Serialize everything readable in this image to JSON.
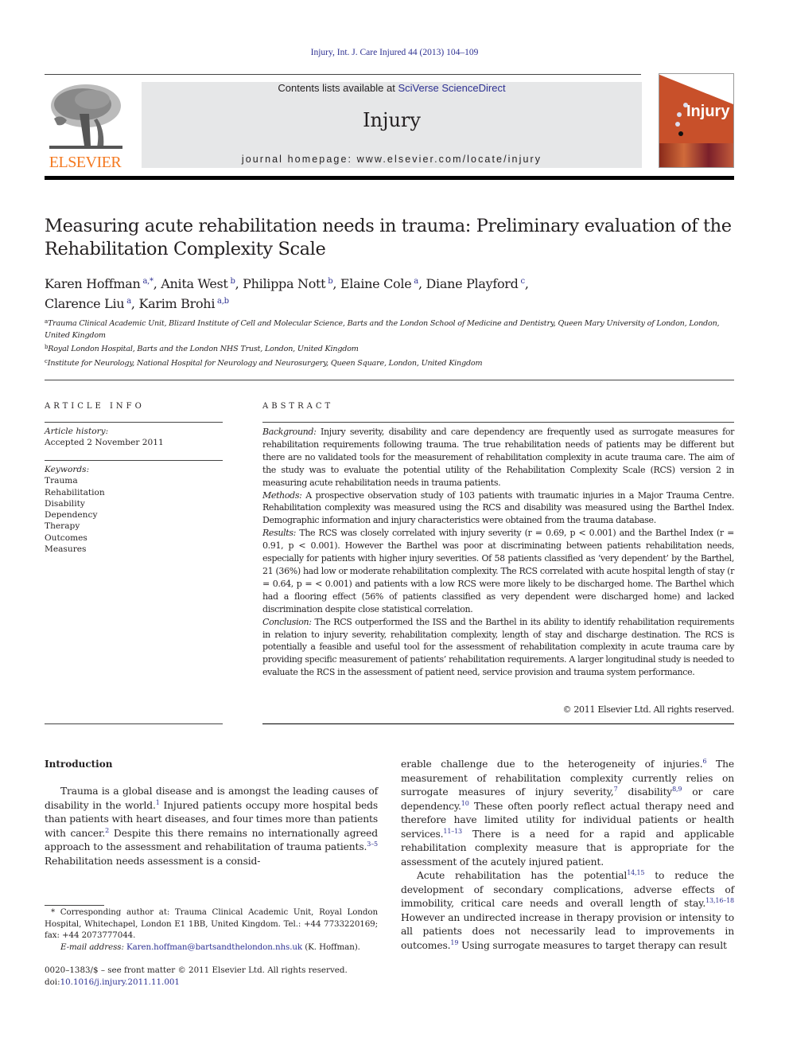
{
  "header": {
    "citation": "Injury, Int. J. Care Injured 44 (2013) 104–109",
    "contents_prefix": "Contents lists available at ",
    "contents_link": "SciVerse ScienceDirect",
    "journal_title": "Injury",
    "homepage": "journal homepage: www.elsevier.com/locate/injury",
    "publisher_wordmark": "ELSEVIER",
    "cover_title": "Injury",
    "colors": {
      "link": "#2e3192",
      "elsevier_orange": "#f47920",
      "banner_bg": "#e6e7e8",
      "cover_bg": "#c8502a"
    }
  },
  "article": {
    "title": "Measuring acute rehabilitation needs in trauma: Preliminary evaluation of the Rehabilitation Complexity Scale",
    "authors": [
      {
        "name": "Karen Hoffman",
        "sup": "a,*",
        "sep": ", "
      },
      {
        "name": "Anita West",
        "sup": "b",
        "sep": ", "
      },
      {
        "name": "Philippa Nott",
        "sup": "b",
        "sep": ", "
      },
      {
        "name": "Elaine Cole",
        "sup": "a",
        "sep": ", "
      },
      {
        "name": "Diane Playford",
        "sup": "c",
        "sep": ","
      },
      {
        "name": "Clarence Liu",
        "sup": "a",
        "sep": ", "
      },
      {
        "name": "Karim Brohi",
        "sup": "a,b",
        "sep": ""
      }
    ],
    "affiliations": [
      {
        "key": "a",
        "text": "Trauma Clinical Academic Unit, Blizard Institute of Cell and Molecular Science, Barts and the London School of Medicine and Dentistry, Queen Mary University of London, London, United Kingdom"
      },
      {
        "key": "b",
        "text": "Royal London Hospital, Barts and the London NHS Trust, London, United Kingdom"
      },
      {
        "key": "c",
        "text": "Institute for Neurology, National Hospital for Neurology and Neurosurgery, Queen Square, London, United Kingdom"
      }
    ]
  },
  "article_info": {
    "heading": "ARTICLE INFO",
    "history_label": "Article history:",
    "history_value": "Accepted 2 November 2011",
    "keywords_label": "Keywords:",
    "keywords": [
      "Trauma",
      "Rehabilitation",
      "Disability",
      "Dependency",
      "Therapy",
      "Outcomes",
      "Measures"
    ]
  },
  "abstract": {
    "heading": "ABSTRACT",
    "sections": [
      {
        "label": "Background:",
        "text": " Injury severity, disability and care dependency are frequently used as surrogate measures for rehabilitation requirements following trauma. The true rehabilitation needs of patients may be different but there are no validated tools for the measurement of rehabilitation complexity in acute trauma care. The aim of the study was to evaluate the potential utility of the Rehabilitation Complexity Scale (RCS) version 2 in measuring acute rehabilitation needs in trauma patients."
      },
      {
        "label": "Methods:",
        "text": " A prospective observation study of 103 patients with traumatic injuries in a Major Trauma Centre. Rehabilitation complexity was measured using the RCS and disability was measured using the Barthel Index. Demographic information and injury characteristics were obtained from the trauma database."
      },
      {
        "label": "Results:",
        "text": " The RCS was closely correlated with injury severity (r = 0.69, p < 0.001) and the Barthel Index (r = 0.91, p < 0.001). However the Barthel was poor at discriminating between patients rehabilitation needs, especially for patients with higher injury severities. Of 58 patients classified as ‘very dependent’ by the Barthel, 21 (36%) had low or moderate rehabilitation complexity. The RCS correlated with acute hospital length of stay (r = 0.64, p = < 0.001) and patients with a low RCS were more likely to be discharged home. The Barthel which had a flooring effect (56% of patients classified as very dependent were discharged home) and lacked discrimination despite close statistical correlation."
      },
      {
        "label": "Conclusion:",
        "text": " The RCS outperformed the ISS and the Barthel in its ability to identify rehabilitation requirements in relation to injury severity, rehabilitation complexity, length of stay and discharge destination. The RCS is potentially a feasible and useful tool for the assessment of rehabilitation complexity in acute trauma care by providing specific measurement of patients’ rehabilitation requirements. A larger longitudinal study is needed to evaluate the RCS in the assessment of patient need, service provision and trauma system performance."
      }
    ],
    "copyright": "© 2011 Elsevier Ltd. All rights reserved."
  },
  "body": {
    "intro_heading": "Introduction",
    "left_paragraphs": [
      [
        {
          "t": "Trauma is a global disease and is amongst the leading causes of disability in the world."
        },
        {
          "s": "1"
        },
        {
          "t": " Injured patients occupy more hospital beds than patients with heart diseases, and four times more than patients with cancer."
        },
        {
          "s": "2"
        },
        {
          "t": " Despite this there remains no internationally agreed approach to the assessment and rehabilitation of trauma patients."
        },
        {
          "s": "3–5"
        },
        {
          "t": " Rehabilitation needs assessment is a consid-"
        }
      ]
    ],
    "right_paragraphs": [
      [
        {
          "t": "erable challenge due to the heterogeneity of injuries."
        },
        {
          "s": "6"
        },
        {
          "t": " The measurement of rehabilitation complexity currently relies on surrogate measures of injury severity,"
        },
        {
          "s": "7"
        },
        {
          "t": " disability"
        },
        {
          "s": "8,9"
        },
        {
          "t": " or care dependency."
        },
        {
          "s": "10"
        },
        {
          "t": " These often poorly reflect actual therapy need and therefore have limited utility for individual patients or health services."
        },
        {
          "s": "11–13"
        },
        {
          "t": " There is a need for a rapid and applicable rehabilitation complexity measure that is appropriate for the assessment of the acutely injured patient."
        }
      ],
      [
        {
          "t": "Acute rehabilitation has the potential"
        },
        {
          "s": "14,15"
        },
        {
          "t": " to reduce the development of secondary complications, adverse effects of immobility, critical care needs and overall length of stay."
        },
        {
          "s": "13,16–18"
        },
        {
          "t": " However an undirected increase in therapy provision or intensity to all patients does not necessarily lead to improvements in outcomes."
        },
        {
          "s": "19"
        },
        {
          "t": " Using surrogate measures to target therapy can result"
        }
      ]
    ]
  },
  "footnotes": {
    "corresponding": "* Corresponding author at: Trauma Clinical Academic Unit, Royal London Hospital, Whitechapel, London E1 1BB, United Kingdom. Tel.: +44 7733220169; fax: +44 2073777044.",
    "email_label": "E-mail address:",
    "email": "Karen.hoffman@bartsandthelondon.nhs.uk",
    "email_suffix": " (K. Hoffman).",
    "front_matter": "0020–1383/$ – see front matter © 2011 Elsevier Ltd. All rights reserved.",
    "doi_label": "doi:",
    "doi": "10.1016/j.injury.2011.11.001"
  }
}
